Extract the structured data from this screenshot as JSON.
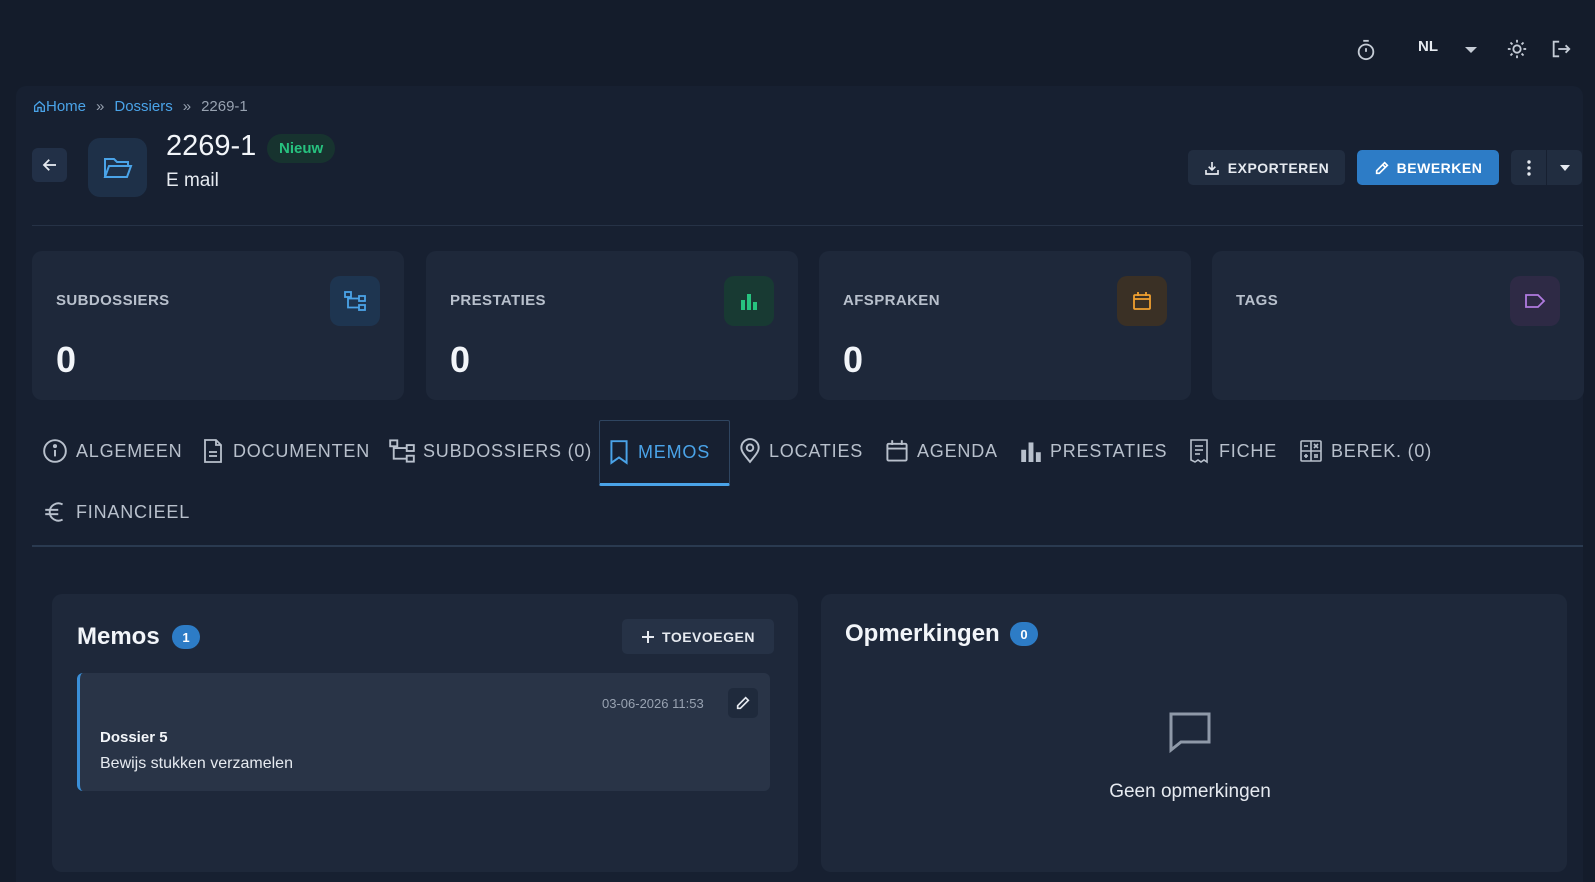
{
  "topbar": {
    "language": "NL",
    "icons": [
      "timer-icon",
      "chevron-down-icon",
      "sun-icon",
      "logout-icon"
    ]
  },
  "breadcrumb": {
    "home": "Home",
    "dossiers": "Dossiers",
    "current": "2269-1",
    "separator": "»"
  },
  "header": {
    "title": "2269-1",
    "status": "Nieuw",
    "subtitle": "E mail",
    "export_label": "EXPORTEREN",
    "edit_label": "BEWERKEN"
  },
  "stats": [
    {
      "label": "SUBDOSSIERS",
      "value": "0",
      "icon": "hierarchy-icon",
      "color": "#4aa3e8"
    },
    {
      "label": "PRESTATIES",
      "value": "0",
      "icon": "bar-chart-icon",
      "color": "#27c27f"
    },
    {
      "label": "AFSPRAKEN",
      "value": "0",
      "icon": "calendar-icon",
      "color": "#f0a030"
    },
    {
      "label": "TAGS",
      "value": "",
      "icon": "tag-icon",
      "color": "#b07be0"
    }
  ],
  "tabs": [
    {
      "label": "ALGEMEEN",
      "icon": "info-icon"
    },
    {
      "label": "DOCUMENTEN",
      "icon": "document-icon"
    },
    {
      "label": "SUBDOSSIERS (0)",
      "icon": "hierarchy-icon"
    },
    {
      "label": "MEMOS",
      "icon": "bookmark-icon",
      "active": true
    },
    {
      "label": "LOCATIES",
      "icon": "location-icon"
    },
    {
      "label": "AGENDA",
      "icon": "calendar-icon"
    },
    {
      "label": "PRESTATIES",
      "icon": "bar-chart-icon"
    },
    {
      "label": "FICHE",
      "icon": "receipt-icon"
    },
    {
      "label": "BEREK. (0)",
      "icon": "calculator-icon"
    },
    {
      "label": "FINANCIEEL",
      "icon": "euro-icon"
    }
  ],
  "memos": {
    "title": "Memos",
    "count": "1",
    "add_label": "TOEVOEGEN",
    "items": [
      {
        "date": "03-06-2026 11:53",
        "title": "Dossier 5",
        "text": "Bewijs stukken verzamelen"
      }
    ]
  },
  "comments": {
    "title": "Opmerkingen",
    "count": "0",
    "empty_text": "Geen opmerkingen"
  },
  "colors": {
    "accent": "#2d7cc6",
    "link": "#4aa3e8",
    "status_new": "#27c27f",
    "background": "#141c2b",
    "card": "#1e283a"
  }
}
